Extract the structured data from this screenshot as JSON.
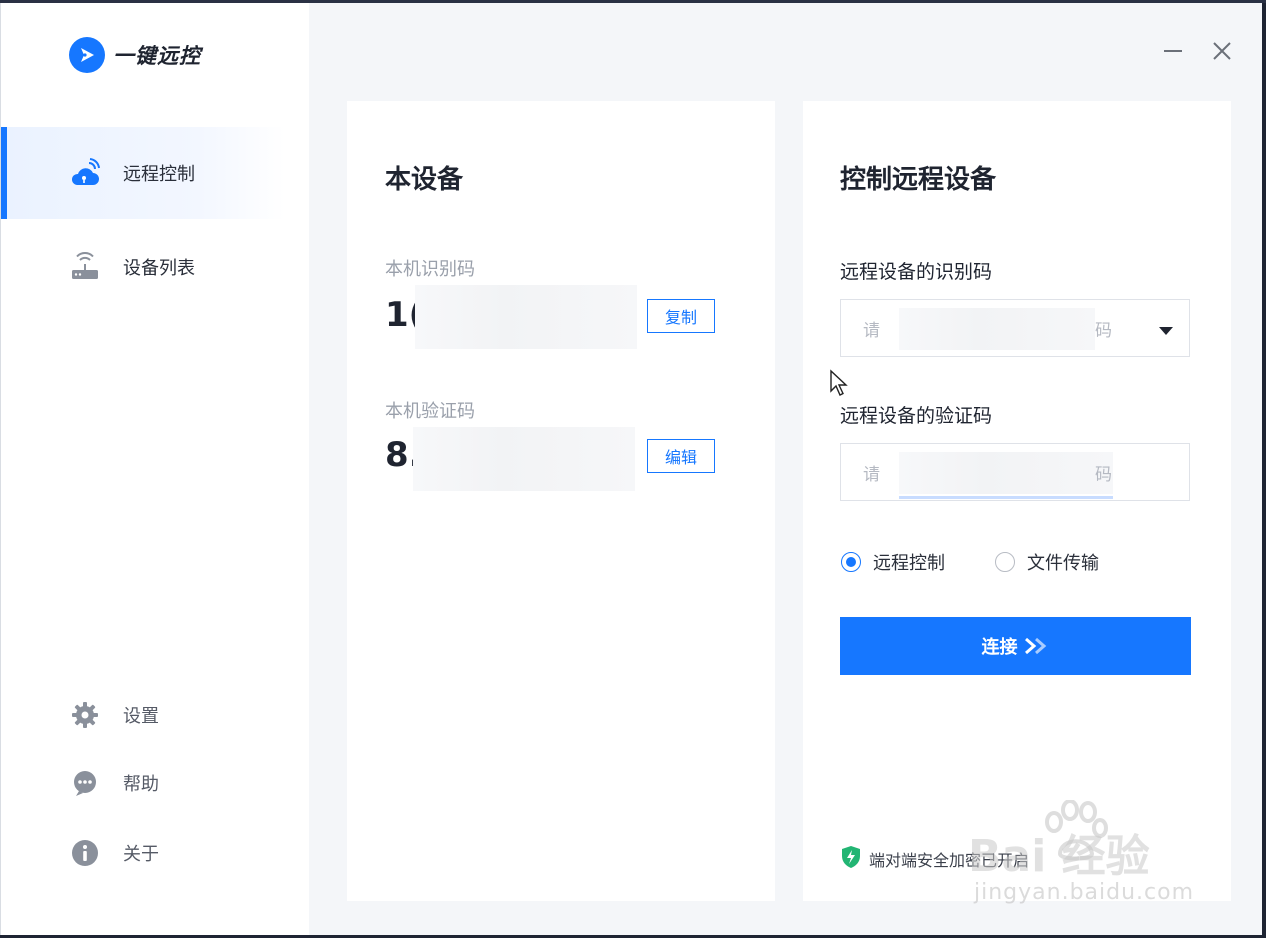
{
  "app": {
    "name": "一键远控"
  },
  "sidebar": {
    "items": [
      {
        "label": "远程控制",
        "icon": "cloud-remote-icon",
        "active": true
      },
      {
        "label": "设备列表",
        "icon": "router-icon",
        "active": false
      }
    ],
    "footer": [
      {
        "label": "设置",
        "icon": "gear-icon"
      },
      {
        "label": "帮助",
        "icon": "chat-help-icon"
      },
      {
        "label": "关于",
        "icon": "info-icon"
      }
    ]
  },
  "window_controls": {
    "minimize": "minimize-icon",
    "close": "close-icon"
  },
  "local_device": {
    "title": "本设备",
    "id_label": "本机识别码",
    "id_value": "1(",
    "copy_label": "复制",
    "code_label": "本机验证码",
    "code_value": "8.",
    "edit_label": "编辑"
  },
  "remote_device": {
    "title": "控制远程设备",
    "id_label": "远程设备的识别码",
    "id_placeholder_start": "请",
    "id_placeholder_end": "码",
    "code_label": "远程设备的验证码",
    "code_placeholder_start": "请",
    "code_placeholder_end": "码",
    "modes": [
      {
        "label": "远程控制",
        "checked": true
      },
      {
        "label": "文件传输",
        "checked": false
      }
    ],
    "connect_label": "连接",
    "security_text": "端对端安全加密已开启"
  },
  "colors": {
    "accent": "#1677ff",
    "shield": "#22b573"
  },
  "watermark": {
    "big": "Bai 经验",
    "small": "jingyan.baidu.com"
  }
}
